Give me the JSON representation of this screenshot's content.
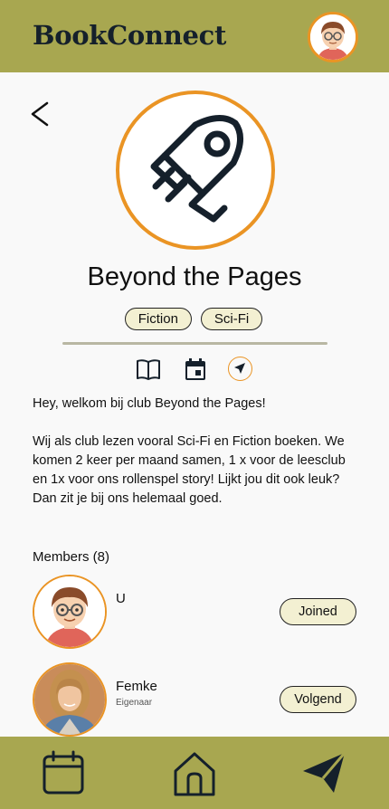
{
  "header": {
    "app_title": "BookConnect",
    "avatar_icon": "user-avatar-icon"
  },
  "club": {
    "name": "Beyond the Pages",
    "logo_icon": "rocket-icon",
    "tags": [
      "Fiction",
      "Sci-Fi"
    ],
    "tabs": [
      {
        "icon": "book-icon"
      },
      {
        "icon": "calendar-icon"
      },
      {
        "icon": "navigation-icon"
      }
    ],
    "description": {
      "line1": "Hey, welkom bij club Beyond the Pages!",
      "line2": "Wij als club lezen vooral Sci-Fi en Fiction boeken. We komen 2 keer per maand samen, 1 x voor de leesclub en 1x voor ons rollenspel story! Lijkt jou dit ook leuk? Dan zit je bij ons helemaal goed."
    }
  },
  "members": {
    "label": "Members (8)",
    "items": [
      {
        "name": "U",
        "role": "",
        "button": "Joined"
      },
      {
        "name": "Femke",
        "role": "Eigenaar",
        "button": "Volgend"
      }
    ]
  },
  "bottom_nav": [
    {
      "icon": "calendar-icon"
    },
    {
      "icon": "home-icon"
    },
    {
      "icon": "send-icon"
    }
  ],
  "colors": {
    "bar": "#a8a750",
    "accent": "#ea9424",
    "chip": "#f3f0d2",
    "dark": "#15202b"
  }
}
